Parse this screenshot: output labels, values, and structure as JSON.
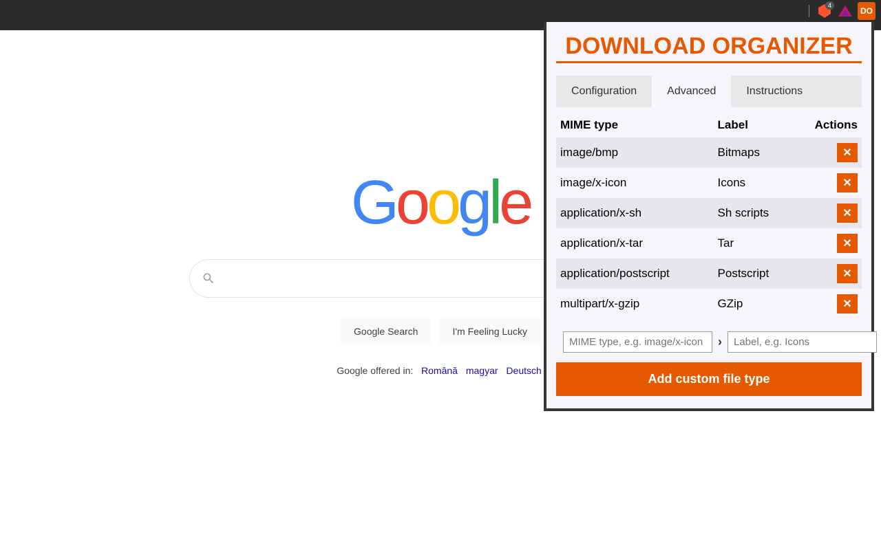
{
  "browser": {
    "brave_badge": "4",
    "do_icon_text": "DO"
  },
  "google": {
    "logo_letters": [
      "G",
      "o",
      "o",
      "g",
      "l",
      "e"
    ],
    "search_placeholder": "",
    "btn_search": "Google Search",
    "btn_lucky": "I'm Feeling Lucky",
    "offered_prefix": "Google offered in:",
    "langs": [
      "Română",
      "magyar",
      "Deutsch"
    ]
  },
  "ext": {
    "title": "DOWNLOAD ORGANIZER",
    "tabs": {
      "config": "Configuration",
      "advanced": "Advanced",
      "instructions": "Instructions"
    },
    "headers": {
      "mime": "MIME type",
      "label": "Label",
      "actions": "Actions"
    },
    "rows": [
      {
        "mime": "image/bmp",
        "label": "Bitmaps"
      },
      {
        "mime": "image/x-icon",
        "label": "Icons"
      },
      {
        "mime": "application/x-sh",
        "label": "Sh scripts"
      },
      {
        "mime": "application/x-tar",
        "label": "Tar"
      },
      {
        "mime": "application/postscript",
        "label": "Postscript"
      },
      {
        "mime": "multipart/x-gzip",
        "label": "GZip"
      }
    ],
    "mime_placeholder": "MIME type, e.g. image/x-icon",
    "label_placeholder": "Label, e.g. Icons",
    "add_btn": "Add custom file type"
  }
}
